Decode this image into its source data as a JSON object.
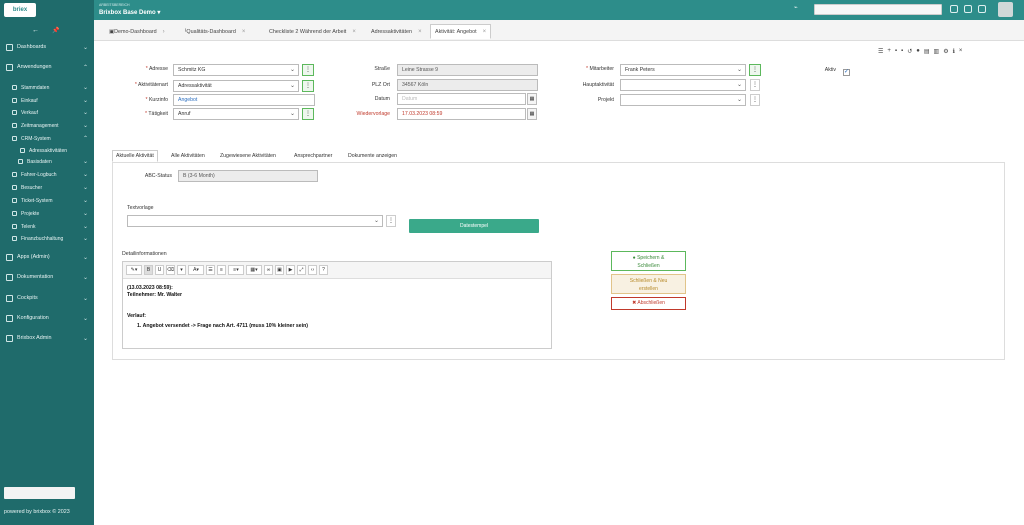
{
  "sidebar": {
    "logo": "briex",
    "items": [
      {
        "label": "Dashboards"
      },
      {
        "label": "Anwendungen"
      },
      {
        "label": "Stammdaten"
      },
      {
        "label": "Einkauf"
      },
      {
        "label": "Verkauf"
      },
      {
        "label": "Zeitmanagement"
      },
      {
        "label": "CRM-System"
      },
      {
        "label": "Adressaktivitäten"
      },
      {
        "label": "Basisdaten"
      },
      {
        "label": "Fahrer-Logbuch"
      },
      {
        "label": "Besucher"
      },
      {
        "label": "Ticket-System"
      },
      {
        "label": "Projekte"
      },
      {
        "label": "Telenk"
      },
      {
        "label": "Finanzbuchhaltung"
      },
      {
        "label": "Apps (Admin)"
      },
      {
        "label": "Dokumentation"
      },
      {
        "label": "Cockpits"
      },
      {
        "label": "Konfiguration"
      },
      {
        "label": "Brixbox Admin"
      }
    ],
    "footer": "powered by brixbox © 2023"
  },
  "topbar": {
    "company_label": "ARBEITSBEREICH",
    "company_name": "Brixbox Base Demo ▾"
  },
  "tabs": [
    {
      "label": "Demo-Dashboard"
    },
    {
      "label": "Qualitäts-Dashboard"
    },
    {
      "label": "Checkliste 2 Während der Arbeit"
    },
    {
      "label": "Adressaktivitäten"
    },
    {
      "label": "Aktivität: Angebot"
    }
  ],
  "form": {
    "adresse_label": "Adresse",
    "adresse_value": "Schmitz KG",
    "aktivitaetenart_label": "Aktivitätenart",
    "aktivitaetenart_value": "Adressaktivität",
    "kurzinfo_label": "Kurzinfo",
    "kurzinfo_value": "Angebot",
    "taetigkeit_label": "Tätigkeit",
    "taetigkeit_value": "Anruf",
    "strasse_label": "Straße",
    "strasse_value": "Leine Strasse 9",
    "plz_label": "PLZ Ort",
    "plz_value": "34567 Köln",
    "datum_label": "Datum",
    "datum_placeholder": "Datum",
    "wiedervorlage_label": "Wiedervorlage",
    "wiedervorlage_value": "17.03.2023 08:59",
    "mitarbeiter_label": "Mitarbeiter",
    "mitarbeiter_value": "Frank Peters",
    "hauptaktivitaet_label": "Hauptaktivität",
    "projekt_label": "Projekt",
    "aktiv_label": "Aktiv",
    "aktiv_checked": "✓"
  },
  "inner_tabs": [
    {
      "label": "Aktuelle Aktivität"
    },
    {
      "label": "Alle Aktivitäten"
    },
    {
      "label": "Zugewiesene Aktivitäten"
    },
    {
      "label": "Ansprechpartner"
    },
    {
      "label": "Dokumente anzeigen"
    }
  ],
  "panel": {
    "abc_label": "ABC-Status",
    "abc_value": "B (3-6 Month)",
    "textvorlage_label": "Textvorlage",
    "status_button": "Datestempel",
    "detail_label": "Detailinformationen",
    "editor_lines": [
      "(13.03.2023 08:59):",
      "Teilnehmer: Mr. Walter",
      "Verlauf:",
      "1. Angebot versendet -> Frage nach Art. 4711 (muss 10% kleiner sein)"
    ]
  },
  "actions": {
    "save_close_1": "Speichern &",
    "save_close_2": "Schließen",
    "save_new_1": "Schließen & Neu",
    "save_new_2": "erstellen",
    "close": "Abschließen"
  },
  "toolbar_icons": [
    "list-icon",
    "plus-icon",
    "save-icon",
    "trash-icon",
    "history-icon",
    "chat-icon",
    "copy-icon",
    "print-icon",
    "settings-icon",
    "info-icon",
    "close-icon"
  ]
}
